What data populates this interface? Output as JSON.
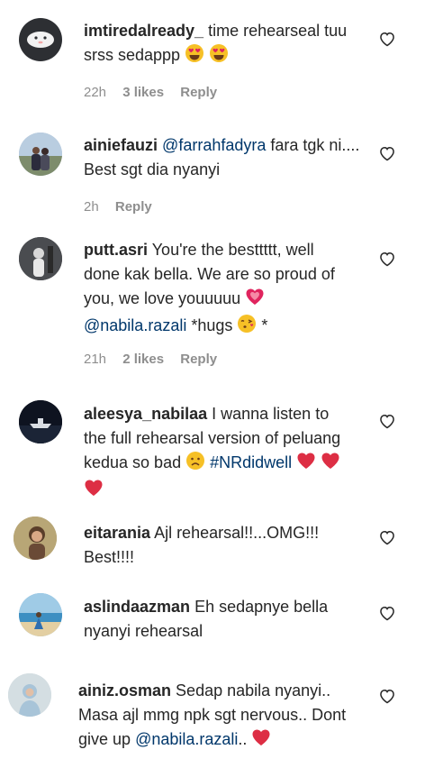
{
  "comments": [
    {
      "username": "imtiredalready_",
      "text": "time rehearseal tuu srss sedappp",
      "time": "22h",
      "likes": "3 likes",
      "reply": "Reply",
      "avatar": "ghost-avatar",
      "emojis": [
        "heart-eyes",
        "heart-eyes"
      ]
    },
    {
      "username": "ainiefauzi",
      "mention": "@farrahfadyra",
      "text": "fara tgk ni.... Best sgt dia nyanyi",
      "time": "2h",
      "reply": "Reply",
      "avatar": "couple-avatar"
    },
    {
      "username": "putt.asri",
      "text": "You're the besttttt, well done kak bella. We are so proud of you, we love youuuuu",
      "mention": "@nabila.razali",
      "text2": "*hugs",
      "text3": "*",
      "time": "21h",
      "likes": "2 likes",
      "reply": "Reply",
      "avatar": "portrait-avatar",
      "emojis": [
        "growing-heart",
        "kissing-face"
      ]
    },
    {
      "username": "aleesya_nabilaa",
      "text": "I wanna listen to the full rehearsal version of peluang kedua so bad",
      "hashtag": "#NRdidwell",
      "avatar": "boat-avatar",
      "emojis": [
        "sad-face",
        "red-heart",
        "red-heart",
        "red-heart"
      ]
    },
    {
      "username": "eitarania",
      "text": "Ajl rehearsal!!...OMG!!! Best!!!!",
      "avatar": "girl-avatar"
    },
    {
      "username": "aslindaazman",
      "text": "Eh sedapnye bella nyanyi rehearsal",
      "avatar": "beach-avatar"
    },
    {
      "username": "ainiz.osman",
      "text": "Sedap nabila nyanyi.. Masa ajl mmg npk sgt nervous.. Dont give up",
      "mention": "@nabila.razali",
      "text2": "..",
      "avatar": "hijab-avatar",
      "emojis": [
        "red-heart"
      ]
    }
  ],
  "colors": {
    "text": "#262626",
    "meta": "#8e8e8e",
    "mention": "#00376b",
    "heart": "#262626"
  }
}
